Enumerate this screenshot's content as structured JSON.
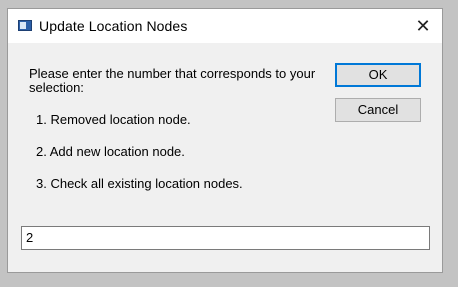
{
  "window": {
    "title": "Update Location Nodes",
    "close_glyph": "✕",
    "icon": "window-app-icon"
  },
  "dialog": {
    "prompt": "Please enter the number that corresponds to your selection:",
    "options": [
      "1. Removed location node.",
      "2. Add new location node.",
      "3. Check all existing location nodes."
    ]
  },
  "buttons": {
    "ok_label": "OK",
    "cancel_label": "Cancel"
  },
  "input": {
    "value": "2"
  },
  "colors": {
    "default_button_border": "#0078d7",
    "dialog_background": "#f0f0f0",
    "titlebar_background": "#ffffff"
  }
}
